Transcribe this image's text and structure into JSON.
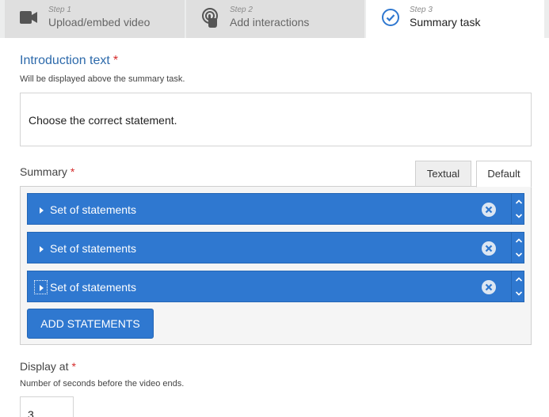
{
  "steps": [
    {
      "step": "Step 1",
      "label": "Upload/embed video",
      "icon": "video-camera-icon"
    },
    {
      "step": "Step 2",
      "label": "Add interactions",
      "icon": "touch-gesture-icon"
    },
    {
      "step": "Step 3",
      "label": "Summary task",
      "icon": "check-circle-icon"
    }
  ],
  "intro": {
    "title": "Introduction text",
    "required_mark": "*",
    "description": "Will be displayed above the summary task.",
    "value": "Choose the correct statement."
  },
  "summary": {
    "label": "Summary",
    "required_mark": "*",
    "tabs": [
      "Textual",
      "Default"
    ],
    "active_tab": "Default",
    "statements": [
      {
        "label": "Set of statements"
      },
      {
        "label": "Set of statements"
      },
      {
        "label": "Set of statements"
      }
    ],
    "add_button": "ADD STATEMENTS"
  },
  "display_at": {
    "label": "Display at",
    "required_mark": "*",
    "description": "Number of seconds before the video ends.",
    "value": "3"
  },
  "colors": {
    "accent": "#2f78d0",
    "title_blue": "#2d6aab",
    "required": "#d52b2b"
  }
}
